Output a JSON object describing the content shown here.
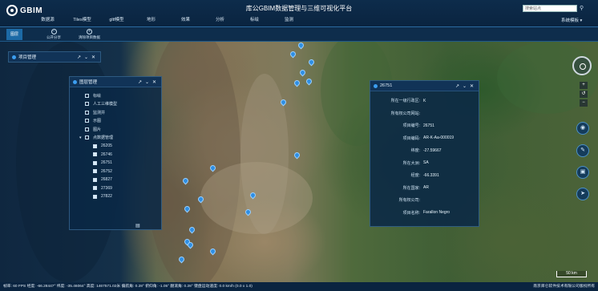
{
  "header": {
    "logo_text": "GBIM",
    "app_title": "库公GBIM数据管理与三维可视化平台",
    "search_placeholder": "搜索站点",
    "system_settings": "系统模板"
  },
  "menu": [
    {
      "label": "数据源"
    },
    {
      "label": "Tiles模型"
    },
    {
      "label": "gltf模型"
    },
    {
      "label": "地形"
    },
    {
      "label": "效果"
    },
    {
      "label": "分析"
    },
    {
      "label": "标绘"
    },
    {
      "label": "监测"
    }
  ],
  "toolbar": {
    "home_label": "图层",
    "share_label": "公开分享",
    "clear_label": "清除项目数据"
  },
  "project_panel": {
    "title": "项目管理"
  },
  "layer_panel": {
    "title": "图层管理",
    "items": [
      {
        "label": "标绘",
        "checked": false
      },
      {
        "label": "人工三维模型",
        "checked": false
      },
      {
        "label": "监测井",
        "checked": false
      },
      {
        "label": "示图",
        "checked": false
      },
      {
        "label": "图片",
        "checked": false
      },
      {
        "label": "点数据管理",
        "checked": false
      }
    ],
    "sub_items": [
      {
        "label": "26205",
        "checked": true
      },
      {
        "label": "26746",
        "checked": true
      },
      {
        "label": "26751",
        "checked": true
      },
      {
        "label": "26752",
        "checked": true
      },
      {
        "label": "26827",
        "checked": true
      },
      {
        "label": "27369",
        "checked": true
      },
      {
        "label": "27822",
        "checked": true
      }
    ]
  },
  "info_panel": {
    "title": "26751",
    "rows": [
      {
        "key": "所在一级行政区:",
        "value": "K"
      },
      {
        "key": "所有权公司网站:",
        "value": ""
      },
      {
        "key": "项目编号:",
        "value": "26751"
      },
      {
        "key": "项目编码:",
        "value": "AR-K-Aa-000019"
      },
      {
        "key": "纬度:",
        "value": "-27.59667"
      },
      {
        "key": "所在大洲:",
        "value": "SA"
      },
      {
        "key": "经度:",
        "value": "-66.3391"
      },
      {
        "key": "所在国家:",
        "value": "AR"
      },
      {
        "key": "所有权公司:",
        "value": ""
      },
      {
        "key": "项目名称:",
        "value": "Farallon Negro"
      }
    ]
  },
  "map": {
    "scale_label": "50 km"
  },
  "statusbar": {
    "text": "帧率: 60 FPS 经度: -66.28447° 纬度: -35.46064° 高度: 1467571.02米 偏航角: 0.28° 俯仰角: -1.05° 翻滚角: 0.28° 键盘运动速度: 0.0 km/h (0.0 x 1.0)",
    "copyright": "南京库仑软件技术有限公司版权所有"
  },
  "colors": {
    "header_bg": "#0a2440",
    "accent": "#3c9ef0",
    "pin": "#2f8fe4"
  }
}
